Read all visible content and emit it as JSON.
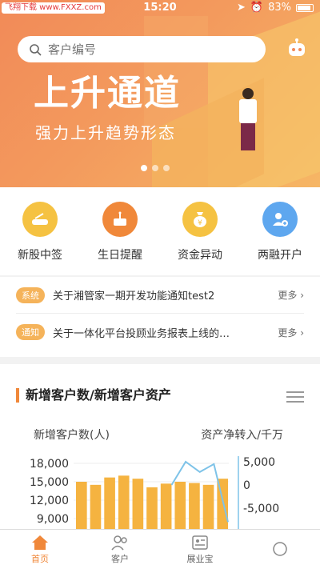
{
  "status_bar": {
    "watermark_left": "飞翔下载 www.FXXZ.com",
    "time": "15:20",
    "battery": "83%"
  },
  "banner": {
    "title": "上升通道",
    "subtitle": "强力上升趋势形态"
  },
  "search": {
    "placeholder": "客户编号"
  },
  "quick_entries": [
    {
      "label": "新股中签",
      "icon": "new-stock-icon",
      "color": "#f5c242"
    },
    {
      "label": "生日提醒",
      "icon": "birthday-cake-icon",
      "color": "#f0883a"
    },
    {
      "label": "资金异动",
      "icon": "money-bag-icon",
      "color": "#f5c242"
    },
    {
      "label": "两融开户",
      "icon": "add-user-icon",
      "color": "#5ea7ef"
    }
  ],
  "notices": [
    {
      "tag": "系统",
      "text": "关于湘管家一期开发功能通知test2",
      "more": "更多"
    },
    {
      "tag": "通知",
      "text": "关于一体化平台投顾业务报表上线的…",
      "more": "更多"
    }
  ],
  "chart_card": {
    "title": "新增客户数/新增客户资产",
    "left_axis_label": "新增客户数(人)",
    "right_axis_label": "资产净转入/千万"
  },
  "chart_data": {
    "type": "bar",
    "title": "新增客户数/新增客户资产",
    "ylabel": "新增客户数(人)",
    "y2label": "资产净转入/千万",
    "left_ticks": [
      "18,000",
      "15,000",
      "12,000",
      "9,000"
    ],
    "right_ticks": [
      "5,000",
      "0",
      "-5,000"
    ],
    "ylim": [
      9000,
      18000
    ],
    "y2lim": [
      -5000,
      5000
    ],
    "series": [
      {
        "values": [
          15000,
          14500,
          15700,
          16000,
          15500,
          14100,
          14700,
          15000,
          14800,
          14500,
          15500
        ],
        "color": "#f5b340"
      },
      {
        "values": [
          null,
          null,
          null,
          null,
          null,
          null,
          null,
          0,
          5000,
          2800,
          4500,
          -8000
        ],
        "color": "#7ec3e8"
      }
    ]
  },
  "tabbar": [
    {
      "label": "首页",
      "icon": "home-icon",
      "active": true
    },
    {
      "label": "客户",
      "icon": "customers-icon",
      "active": false
    },
    {
      "label": "展业宝",
      "icon": "business-card-icon",
      "active": false
    },
    {
      "label": "",
      "icon": "more-icon",
      "active": false
    }
  ],
  "colors": {
    "accent": "#f0883a",
    "tag": "#f5b35a"
  }
}
